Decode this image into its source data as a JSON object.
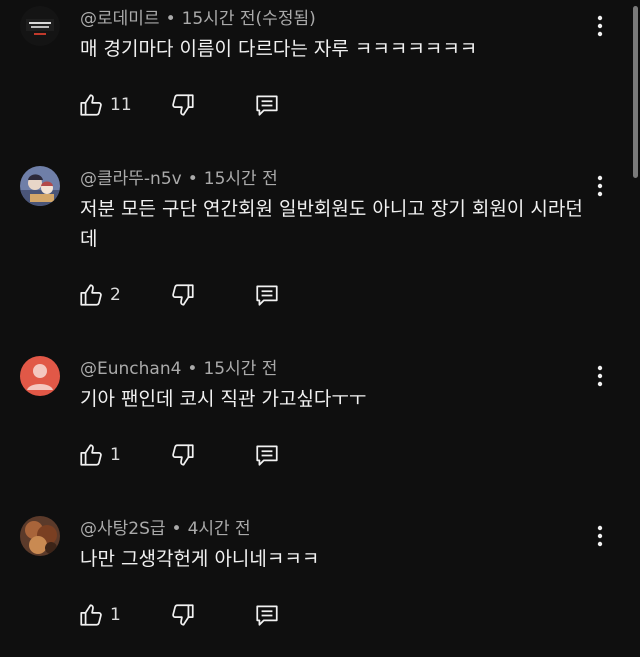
{
  "comments": [
    {
      "author": "@로데미르",
      "time": "15시간 전(수정됨)",
      "text": "매 경기마다 이름이 다르다는 자루 ㅋㅋㅋㅋㅋㅋㅋ",
      "likes": "11",
      "avatar": "dark-logo-avatar"
    },
    {
      "author": "@클라뚜-n5v",
      "time": "15시간 전",
      "text": "저분 모든 구단 연간회원 일반회원도 아니고 장기 회원이 시라던데",
      "likes": "2",
      "avatar": "illustration-avatar"
    },
    {
      "author": "@Eunchan4",
      "time": "15시간 전",
      "text": "기아 팬인데 코시 직관 가고싶다ㅜㅜ",
      "likes": "1",
      "avatar": "default-person-avatar"
    },
    {
      "author": "@사탕2S급",
      "time": "4시간 전",
      "text": "나만 그생각헌게 아니네ㅋㅋㅋ",
      "likes": "1",
      "avatar": "photo-avatar"
    }
  ],
  "icons": {
    "like": "thumb-up-icon",
    "dislike": "thumb-down-icon",
    "reply": "reply-icon",
    "menu": "more-vert-icon"
  },
  "colors": {
    "background": "#0f0f0f",
    "text": "#f1f1f1",
    "meta": "#aaaaaa",
    "default_avatar": "#e15847"
  }
}
